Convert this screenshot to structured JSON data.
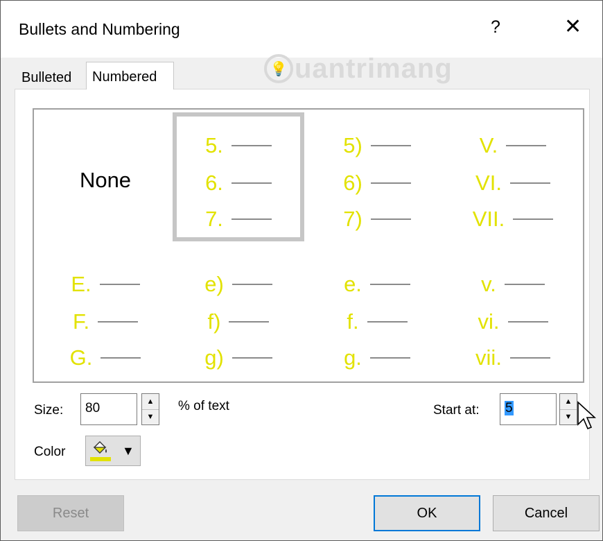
{
  "window": {
    "title": "Bullets and Numbering",
    "help_label": "?",
    "close_label": "✕"
  },
  "watermark": {
    "text": "uantrimang"
  },
  "tabs": [
    {
      "label": "Bulleted",
      "active": false
    },
    {
      "label": "Numbered",
      "active": true
    }
  ],
  "gallery": {
    "number_color": "#e2e200",
    "cells": [
      {
        "type": "none",
        "label": "None"
      },
      {
        "type": "list",
        "items": [
          "5.",
          "6.",
          "7."
        ],
        "selected": true
      },
      {
        "type": "list",
        "items": [
          "5)",
          "6)",
          "7)"
        ]
      },
      {
        "type": "list",
        "items": [
          "V.",
          "VI.",
          "VII."
        ]
      },
      {
        "type": "list",
        "items": [
          "E.",
          "F.",
          "G."
        ]
      },
      {
        "type": "list",
        "items": [
          "e)",
          "f)",
          "g)"
        ]
      },
      {
        "type": "list",
        "items": [
          "e.",
          "f.",
          "g."
        ]
      },
      {
        "type": "list",
        "items": [
          "v.",
          "vi.",
          "vii."
        ]
      }
    ]
  },
  "size": {
    "label": "Size:",
    "value": "80",
    "suffix": "% of text"
  },
  "start_at": {
    "label": "Start at:",
    "value": "5"
  },
  "color": {
    "label": "Color",
    "swatch": "#e2e200",
    "icon": "paint-bucket-icon"
  },
  "buttons": {
    "reset": "Reset",
    "ok": "OK",
    "cancel": "Cancel"
  }
}
